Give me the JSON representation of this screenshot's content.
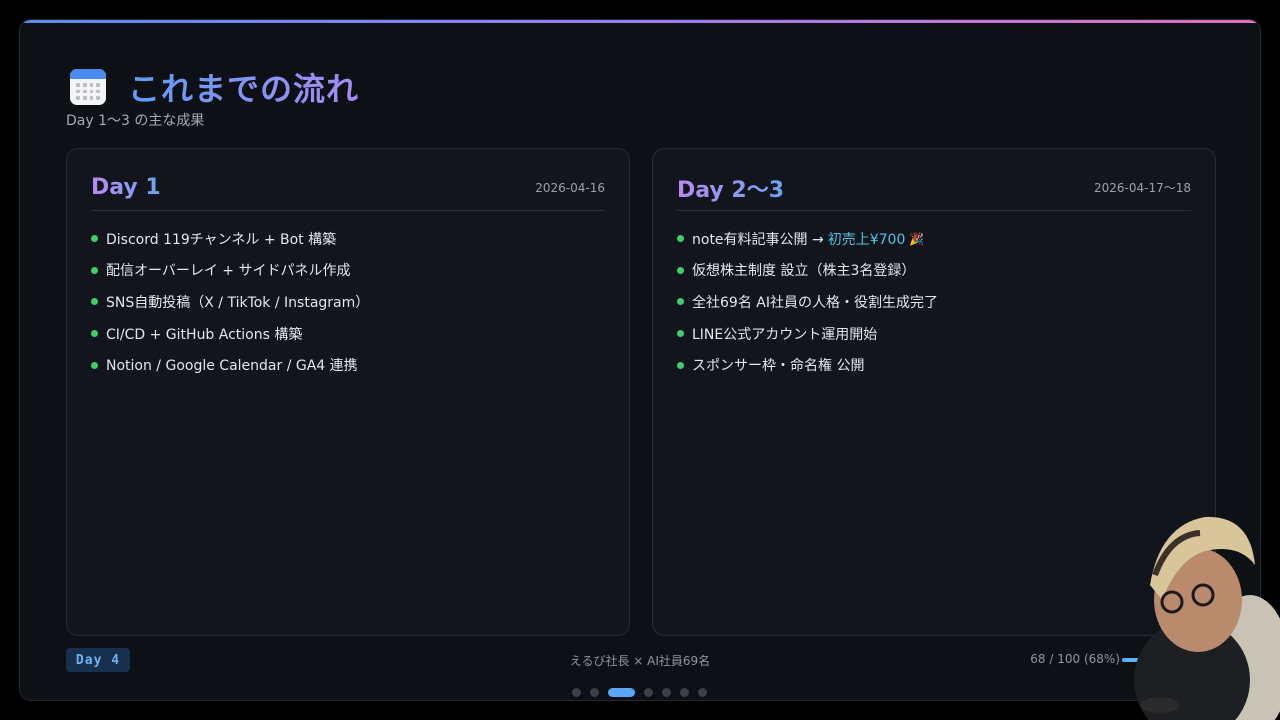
{
  "header": {
    "icon": "calendar-icon",
    "title": "これまでの流れ",
    "subtitle": "Day 1〜3 の主な成果"
  },
  "cards": [
    {
      "title": "Day 1",
      "date": "2026-04-16",
      "items": [
        "Discord 119チャンネル + Bot 構築",
        "配信オーバーレイ + サイドパネル作成",
        "SNS自動投稿（X / TikTok / Instagram）",
        "CI/CD + GitHub Actions 構築",
        "Notion / Google Calendar / GA4 連携"
      ]
    },
    {
      "title": "Day 2〜3",
      "date": "2026-04-17〜18",
      "items": [
        "note有料記事公開 →",
        "仮想株主制度 設立（株主3名登録）",
        "全社69名 AI社員の人格・役割生成完了",
        "LINE公式アカウント運用開始",
        "スポンサー枠・命名権 公開"
      ],
      "highlight": "初売上¥700",
      "emoji": "🎉"
    }
  ],
  "footer": {
    "day_badge": "Day 4",
    "center": "えるび社長 × AI社員69名",
    "progress_text": "68 / 100 (68%)",
    "progress_value": 0.68
  },
  "pagination": {
    "count": 7,
    "active_index": 2
  },
  "colors": {
    "accent": "#5aa8f5",
    "bullet": "#3ecf6a",
    "highlight": "#4fc3e8"
  }
}
